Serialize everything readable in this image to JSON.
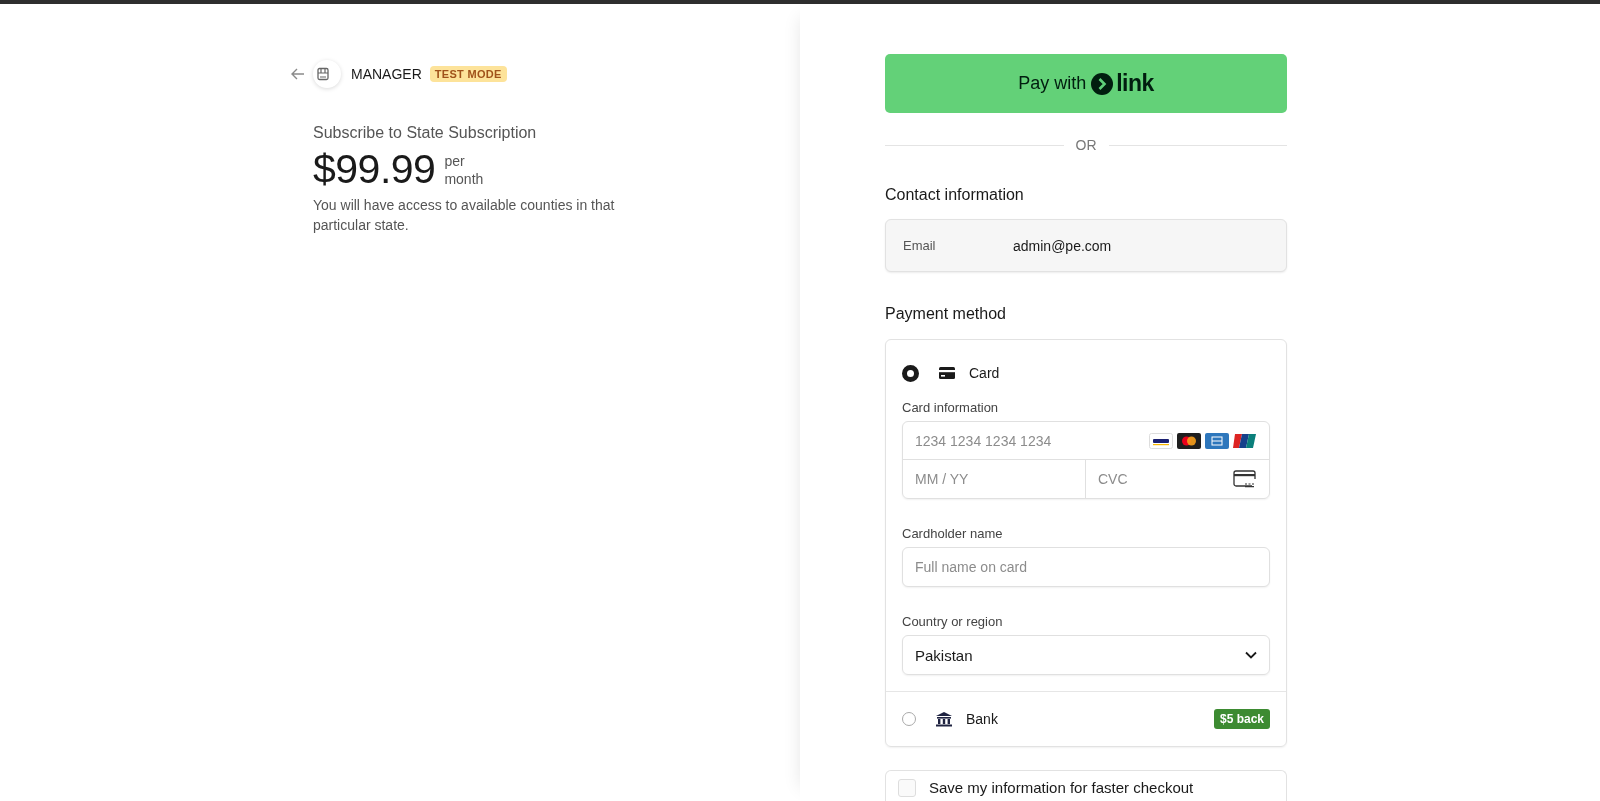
{
  "header": {
    "merchant": "MANAGER",
    "badge": "TEST MODE"
  },
  "product": {
    "title": "Subscribe to State Subscription",
    "price": "$99.99",
    "interval_line_1": "per",
    "interval_line_2": "month",
    "description": "You will have access to available counties in that particular state."
  },
  "pay_button": {
    "label": "Pay with",
    "brand": "link"
  },
  "separator": "OR",
  "contact": {
    "heading": "Contact information",
    "email_label": "Email",
    "email_value": "admin@pe.com"
  },
  "payment": {
    "heading": "Payment method",
    "methods": [
      {
        "kind": "card",
        "label": "Card",
        "selected": true
      },
      {
        "kind": "bank",
        "label": "Bank",
        "selected": false,
        "badge": "$5 back"
      }
    ],
    "card_form": {
      "card_label": "Card information",
      "number_placeholder": "1234 1234 1234 1234",
      "expiry_placeholder": "MM / YY",
      "cvc_placeholder": "CVC",
      "name_label": "Cardholder name",
      "name_placeholder": "Full name on card",
      "country_label": "Country or region",
      "country_value": "Pakistan"
    }
  },
  "save_info": {
    "checked": false,
    "label": "Save my information for faster checkout"
  }
}
